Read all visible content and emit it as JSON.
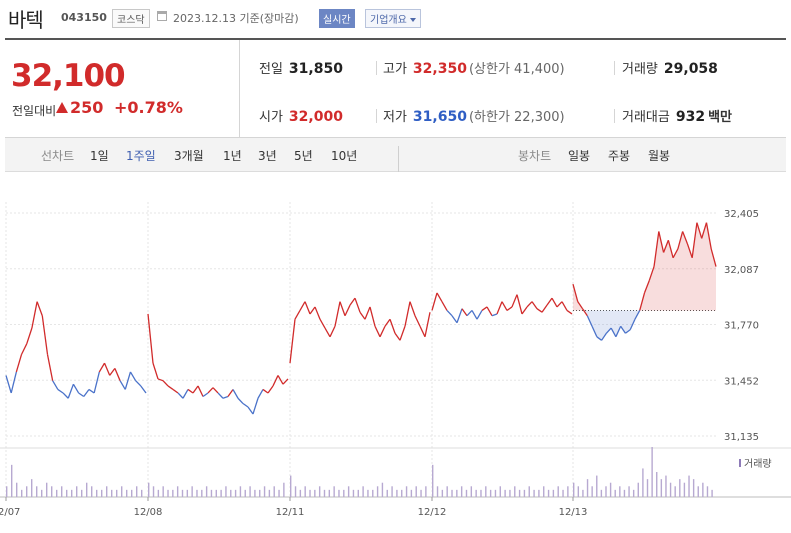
{
  "header": {
    "name": "바텍",
    "code": "043150",
    "market": "코스닥",
    "asof": "2023.12.13  기준(장마감)",
    "realtime": "실시간",
    "company_overview": "기업개요"
  },
  "summary": {
    "price": "32,100",
    "change_label": "전일대비",
    "change": "250",
    "change_pct": "+0.78%",
    "prev_close": {
      "label": "전일",
      "value": "31,850"
    },
    "high": {
      "label": "고가",
      "value": "32,350",
      "limit": "(상한가 41,400)"
    },
    "volume": {
      "label": "거래량",
      "value": "29,058"
    },
    "open": {
      "label": "시가",
      "value": "32,000"
    },
    "low": {
      "label": "저가",
      "value": "31,650",
      "limit": "(하한가 22,300)"
    },
    "amount": {
      "label": "거래대금",
      "value": "932",
      "unit": "백만"
    }
  },
  "toolbar": {
    "line_chart": "선차트",
    "periods": [
      "1일",
      "1주일",
      "3개월",
      "1년",
      "3년",
      "5년",
      "10년"
    ],
    "active_period": "1주일",
    "candle_chart": "봉차트",
    "candles": [
      "일봉",
      "주봉",
      "월봉"
    ]
  },
  "colors": {
    "up": "#d12b2b",
    "down": "#4a72c9",
    "volume": "#b7a9d1"
  },
  "chart_data": {
    "type": "line",
    "yticks": [
      "32,405",
      "32,087",
      "31,770",
      "31,452",
      "31,135"
    ],
    "ylim": [
      31135,
      32405
    ],
    "xticks": [
      "12/07",
      "12/08",
      "12/11",
      "12/12",
      "12/13"
    ],
    "reference_price": 31850,
    "volume_legend": "거래량",
    "days": [
      {
        "date": "12/07",
        "prices": [
          31480,
          31380,
          31500,
          31600,
          31660,
          31750,
          31900,
          31820,
          31600,
          31450,
          31400,
          31380,
          31350,
          31430,
          31380,
          31360,
          31400,
          31380,
          31500,
          31550,
          31480,
          31520,
          31450,
          31400,
          31500,
          31450,
          31420,
          31380
        ]
      },
      {
        "date": "12/08",
        "prices": [
          31830,
          31550,
          31460,
          31450,
          31420,
          31400,
          31380,
          31350,
          31400,
          31380,
          31420,
          31360,
          31380,
          31410,
          31380,
          31350,
          31360,
          31400,
          31350,
          31320,
          31300,
          31260,
          31350,
          31400,
          31380,
          31420,
          31480,
          31430,
          31460
        ]
      },
      {
        "date": "12/11",
        "prices": [
          31550,
          31800,
          31850,
          31900,
          31830,
          31870,
          31800,
          31750,
          31700,
          31760,
          31900,
          31820,
          31880,
          31920,
          31840,
          31800,
          31870,
          31760,
          31700,
          31760,
          31800,
          31720,
          31680,
          31760,
          31900,
          31820,
          31760,
          31700,
          31840
        ]
      },
      {
        "date": "12/12",
        "prices": [
          31850,
          31950,
          31900,
          31850,
          31820,
          31780,
          31860,
          31820,
          31850,
          31800,
          31850,
          31870,
          31820,
          31830,
          31900,
          31850,
          31870,
          31940,
          31830,
          31870,
          31900,
          31860,
          31840,
          31880,
          31920,
          31870,
          31900,
          31850,
          31830
        ]
      },
      {
        "date": "12/13",
        "prices": [
          32000,
          31900,
          31860,
          31820,
          31760,
          31700,
          31680,
          31720,
          31750,
          31700,
          31760,
          31720,
          31740,
          31800,
          31850,
          31950,
          32020,
          32100,
          32300,
          32180,
          32250,
          32150,
          32200,
          32300,
          32230,
          32150,
          32350,
          32260,
          32350,
          32200,
          32100
        ]
      }
    ],
    "volumes": [
      [
        3,
        9,
        4,
        2,
        3,
        5,
        3,
        2,
        4,
        3,
        2,
        3,
        2,
        2,
        3,
        2,
        4,
        3,
        2,
        2,
        3,
        2,
        2,
        3,
        2,
        2,
        3,
        2
      ],
      [
        4,
        3,
        2,
        3,
        2,
        2,
        3,
        2,
        2,
        3,
        2,
        2,
        3,
        2,
        2,
        2,
        3,
        2,
        2,
        3,
        2,
        3,
        2,
        2,
        3,
        2,
        3,
        2,
        4
      ],
      [
        6,
        3,
        2,
        3,
        2,
        2,
        3,
        2,
        2,
        3,
        2,
        2,
        3,
        2,
        2,
        3,
        2,
        2,
        3,
        4,
        2,
        3,
        2,
        2,
        3,
        2,
        3,
        2,
        3
      ],
      [
        9,
        3,
        2,
        3,
        2,
        2,
        3,
        2,
        3,
        2,
        2,
        3,
        2,
        2,
        3,
        2,
        2,
        3,
        2,
        2,
        3,
        2,
        2,
        3,
        2,
        2,
        3,
        2,
        3
      ],
      [
        4,
        3,
        2,
        5,
        3,
        6,
        2,
        3,
        4,
        2,
        3,
        2,
        3,
        2,
        4,
        8,
        5,
        14,
        7,
        5,
        6,
        4,
        3,
        5,
        4,
        6,
        5,
        3,
        4,
        3,
        2
      ]
    ]
  }
}
